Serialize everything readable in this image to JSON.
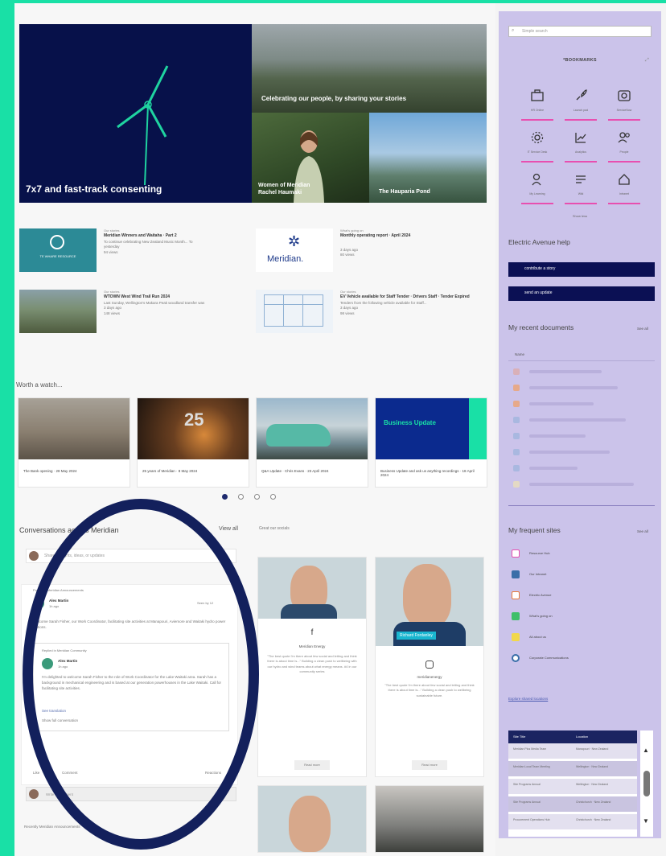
{
  "hero": {
    "main_caption": "7x7 and fast-track consenting",
    "top_right_caption": "Celebrating our people, by sharing your stories",
    "bottom_left_caption_1": "Women of Meridian",
    "bottom_left_caption_2": "Rachel Haumaki",
    "bottom_right_caption": "The Hauparia Pond"
  },
  "news": [
    {
      "cat": "Our stories",
      "title": "Meridian Winners and Waitaha · Part 2",
      "snip": "To continue celebrating New Zealand Music Month... To",
      "time": "yesterday",
      "views": "94 views"
    },
    {
      "cat": "What's going on",
      "title": "Monthly operating report · April 2024",
      "snip": "",
      "time": "3 days ago",
      "views": "80 views"
    },
    {
      "cat": "Our stories",
      "title": "WTOWN West Wind Trail Run 2024",
      "snip": "Last Sunday, Wellington's Makara Peak woodland transfer was",
      "time": "3 days ago",
      "views": "148 views"
    },
    {
      "cat": "Our stories",
      "title": "EV Vehicle available for Staff Tender · Drivers Staff · Tender Expired",
      "snip": "Tenders from the following vehicle available for Staff...",
      "time": "3 days ago",
      "views": "98 views"
    }
  ],
  "news_logo_text": "Meridian.",
  "news_logo_small": "TE WHARE RESOURCE",
  "worth_watch_title": "Worth a watch...",
  "videos": [
    {
      "cap": "The Bank opening · 28 May 2024"
    },
    {
      "cap": "25 years of Meridian · 8 May 2024"
    },
    {
      "cap": "Q&A Update · Chris Evans · 23 April 2024"
    },
    {
      "cap": "Business Update and ask us anything recordings · 18 April 2024"
    }
  ],
  "video_banner": "Business Update",
  "video_25": "25",
  "conversations": {
    "title": "Conversations across Meridian",
    "view_all": "View all",
    "share_placeholder": "Share thoughts, ideas, or updates",
    "posted_in": "Posted in Meridian Announcements",
    "author": "Alex Martin",
    "time": "1h ago",
    "seen": "Seen by 12",
    "body": "Welcome Sarah Fisher, our Work Coordinator, facilitating site activities at Manapouri, Aviemore and Waitaki hydro power stations.",
    "inner_posted": "Replied in Meridian Community",
    "inner_author": "Alex Martin",
    "inner_time": "1h ago",
    "inner_body": "I'm delighted to welcome Sarah Fisher to the role of Work Coordinator for the Lake Waitaki area. Sarah has a background in mechanical engineering and is based at our generation powerhouses in the Lake Waitaki. Call for facilitating site activities.",
    "inner_link": "See translation",
    "inner_more": "Show full conversation",
    "like": "Like",
    "comment": "Comment",
    "react": "Reactions",
    "reply": "Write a comment",
    "footer": "Recently Meridian Announcements"
  },
  "social": {
    "title": "Great our socials",
    "card1_name": "Meridian Energy",
    "card1_text": "\"The best quote I'm there about few social and letting and think there is about time is...\" Building a clean push to wellbeing with our hydro and wind teams about what energy means. #4 in our community series",
    "card1_more": "Read more",
    "card2_name": "meridianenergy",
    "card2_badge": "Richard Fordanley",
    "card2_text": "\"The best quote I'm there about few social and letting and think there is about time is...\" Building a clean push to wellbeing sustainable future.",
    "card2_more": "Read more"
  },
  "sidebar": {
    "search_placeholder": "Simple search",
    "quick_title": "*BOOKMARKS",
    "quick": [
      "HR Online",
      "Launch pad",
      "ServiceNow",
      "IT Service Desk",
      "Analytics",
      "People",
      "My Learning",
      "Wiki",
      "Intranet"
    ],
    "show_more": "Show less",
    "help_title": "Electric Avenue help",
    "help_buttons": [
      "contribute a story",
      "send an update"
    ],
    "recent_title": "My recent documents",
    "recent_see_all": "See all",
    "recent_name_header": "Name",
    "frequent_title": "My frequent sites",
    "frequent_see_all": "See all",
    "sites": [
      "Resource Hub",
      "Our Intranet",
      "Electric Avenue",
      "What's going on",
      "All about us",
      "Corporate Communications"
    ],
    "explore_link": "Explore shared locations",
    "table_headers": [
      "Site Title",
      "Location"
    ],
    "table_rows": [
      [
        "Meridian Plus Media Team",
        "Manapouri · New Zealand"
      ],
      [
        "Meridian Local Team Meeting",
        "Wellington · New Zealand"
      ],
      [
        "Site Programs Annual",
        "Wellington · New Zealand"
      ],
      [
        "Site Programs Annual",
        "Christchurch · New Zealand"
      ],
      [
        "Procurement Operations Hub",
        "Christchurch · New Zealand"
      ]
    ]
  },
  "colors": {
    "accent_green": "#19e0a6",
    "navy": "#0b1054",
    "sidebar_lavender": "#cbc3ea",
    "pink": "#e84fb0"
  }
}
